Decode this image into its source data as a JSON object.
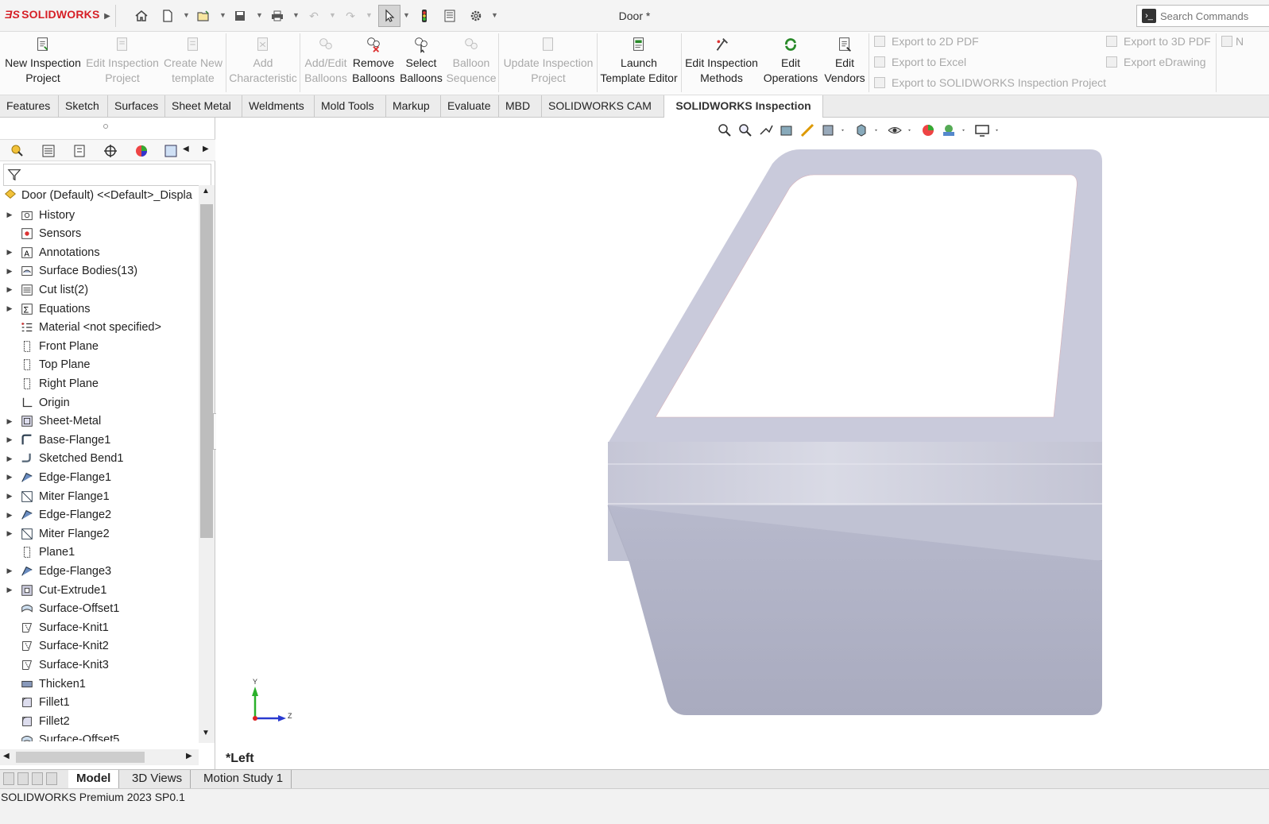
{
  "app": {
    "logo_text": "SOLIDWORKS",
    "document_title": "Door *"
  },
  "search": {
    "placeholder": "Search Commands"
  },
  "ribbon": {
    "buttons": [
      {
        "label": "New Inspection Project",
        "enabled": true
      },
      {
        "label": "Edit Inspection Project",
        "enabled": false
      },
      {
        "label": "Create New template",
        "enabled": false
      },
      {
        "label": "Add Characteristic",
        "enabled": false
      },
      {
        "label": "Add/Edit Balloons",
        "enabled": false
      },
      {
        "label": "Remove Balloons",
        "enabled": true
      },
      {
        "label": "Select Balloons",
        "enabled": true
      },
      {
        "label": "Balloon Sequence",
        "enabled": false
      },
      {
        "label": "Update Inspection Project",
        "enabled": false
      },
      {
        "label": "Launch Template Editor",
        "enabled": true
      },
      {
        "label": "Edit Inspection Methods",
        "enabled": true
      },
      {
        "label": "Edit Operations",
        "enabled": true
      },
      {
        "label": "Edit Vendors",
        "enabled": true
      }
    ],
    "export_items": [
      {
        "label": "Export to 2D PDF"
      },
      {
        "label": "Export to Excel"
      },
      {
        "label": "Export to SOLIDWORKS Inspection Project"
      },
      {
        "label": "Export to 3D PDF"
      },
      {
        "label": "Export eDrawing"
      }
    ],
    "overflow_label": "N"
  },
  "tabs": [
    "Features",
    "Sketch",
    "Surfaces",
    "Sheet Metal",
    "Weldments",
    "Mold Tools",
    "Markup",
    "Evaluate",
    "MBD",
    "SOLIDWORKS CAM",
    "SOLIDWORKS Inspection"
  ],
  "active_tab": "SOLIDWORKS Inspection",
  "tree": {
    "root": "Door (Default) <<Default>_Displa",
    "items": [
      {
        "label": "History",
        "icon": "history-folder-icon",
        "expandable": true
      },
      {
        "label": "Sensors",
        "icon": "sensors-icon",
        "expandable": false
      },
      {
        "label": "Annotations",
        "icon": "annotations-icon",
        "expandable": true
      },
      {
        "label": "Surface Bodies(13)",
        "icon": "surface-bodies-icon",
        "expandable": true
      },
      {
        "label": "Cut list(2)",
        "icon": "cut-list-icon",
        "expandable": true
      },
      {
        "label": "Equations",
        "icon": "equations-icon",
        "expandable": true
      },
      {
        "label": "Material <not specified>",
        "icon": "material-icon",
        "expandable": false
      },
      {
        "label": "Front Plane",
        "icon": "plane-icon",
        "expandable": false
      },
      {
        "label": "Top Plane",
        "icon": "plane-icon",
        "expandable": false
      },
      {
        "label": "Right Plane",
        "icon": "plane-icon",
        "expandable": false
      },
      {
        "label": "Origin",
        "icon": "origin-icon",
        "expandable": false
      },
      {
        "label": "Sheet-Metal",
        "icon": "sheet-metal-icon",
        "expandable": true
      },
      {
        "label": "Base-Flange1",
        "icon": "base-flange-icon",
        "expandable": true
      },
      {
        "label": "Sketched Bend1",
        "icon": "sketched-bend-icon",
        "expandable": true
      },
      {
        "label": "Edge-Flange1",
        "icon": "edge-flange-icon",
        "expandable": true
      },
      {
        "label": "Miter Flange1",
        "icon": "miter-flange-icon",
        "expandable": true
      },
      {
        "label": "Edge-Flange2",
        "icon": "edge-flange-icon",
        "expandable": true
      },
      {
        "label": "Miter Flange2",
        "icon": "miter-flange-icon",
        "expandable": true
      },
      {
        "label": "Plane1",
        "icon": "plane-icon",
        "expandable": false
      },
      {
        "label": "Edge-Flange3",
        "icon": "edge-flange-icon",
        "expandable": true
      },
      {
        "label": "Cut-Extrude1",
        "icon": "cut-extrude-icon",
        "expandable": true
      },
      {
        "label": "Surface-Offset1",
        "icon": "surface-offset-icon",
        "expandable": false
      },
      {
        "label": "Surface-Knit1",
        "icon": "surface-knit-icon",
        "expandable": false
      },
      {
        "label": "Surface-Knit2",
        "icon": "surface-knit-icon",
        "expandable": false
      },
      {
        "label": "Surface-Knit3",
        "icon": "surface-knit-icon",
        "expandable": false
      },
      {
        "label": "Thicken1",
        "icon": "thicken-icon",
        "expandable": false
      },
      {
        "label": "Fillet1",
        "icon": "fillet-icon",
        "expandable": false
      },
      {
        "label": "Fillet2",
        "icon": "fillet-icon",
        "expandable": false
      },
      {
        "label": "Surface-Offset5",
        "icon": "surface-offset-icon",
        "expandable": false
      }
    ]
  },
  "viewport": {
    "view_label": "*Left",
    "triad": {
      "y": "Y",
      "z": "Z"
    }
  },
  "bottom_tabs": [
    "Model",
    "3D Views",
    "Motion Study 1"
  ],
  "active_bottom_tab": "Model",
  "status": {
    "text": "SOLIDWORKS Premium 2023 SP0.1"
  },
  "colors": {
    "brand": "#d61f26",
    "body_fill": "#c9cadb",
    "accent_active_tab": "#ffffff"
  }
}
